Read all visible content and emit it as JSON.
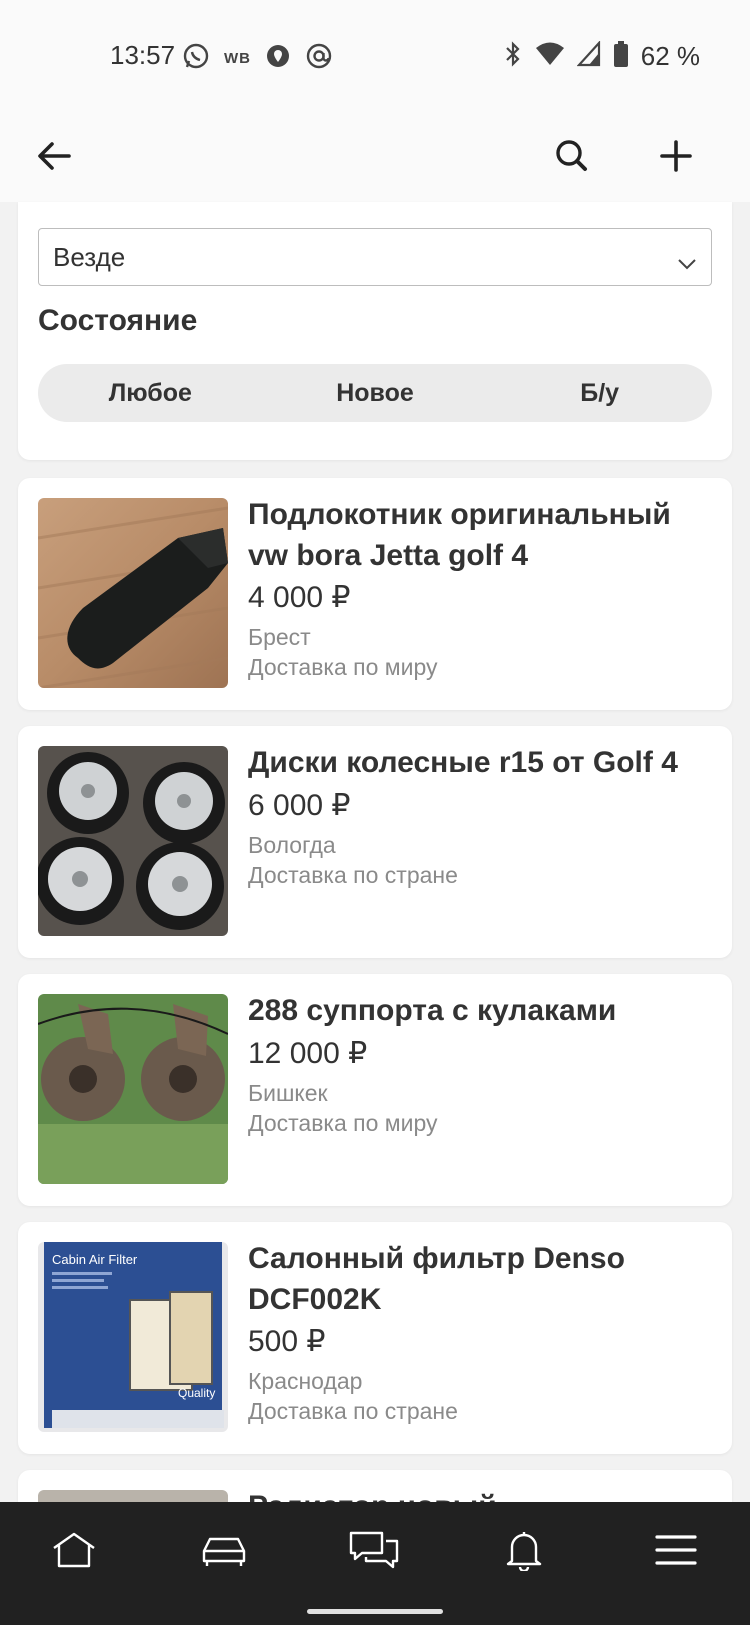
{
  "status_bar": {
    "time": "13:57",
    "wb_label": "WB",
    "battery": "62 %"
  },
  "app_bar": {
    "back_icon": "arrow-left-icon",
    "search_icon": "search-icon",
    "add_icon": "plus-icon"
  },
  "filters": {
    "location_value": "Везде",
    "condition_title": "Состояние",
    "condition_options": [
      "Любое",
      "Новое",
      "Б/у"
    ]
  },
  "listings": [
    {
      "title_line1": "Подлокотник оригинальный",
      "title_line2": "vw bora Jetta golf 4",
      "price": "4 000 ₽",
      "city": "Брест",
      "delivery": "Доставка по миру"
    },
    {
      "title_line1": "Диски колесные r15 от Golf 4",
      "title_line2": "",
      "price": "6 000 ₽",
      "city": "Вологда",
      "delivery": "Доставка по стране"
    },
    {
      "title_line1": "288 суппорта с кулаками",
      "title_line2": "",
      "price": "12 000 ₽",
      "city": "Бишкек",
      "delivery": "Доставка по миру"
    },
    {
      "title_line1": "Салонный фильтр Denso",
      "title_line2": "DCF002K",
      "price": "500 ₽",
      "city": "Краснодар",
      "delivery": "Доставка по стране",
      "image_text": "Cabin Air Filter",
      "image_brand": "Quality"
    },
    {
      "title_line1": "Радиатор новый",
      "title_line2": ""
    }
  ],
  "bottom_nav": {
    "items": [
      "home-icon",
      "car-icon",
      "chat-icon",
      "bell-icon",
      "menu-icon"
    ]
  },
  "colors": {
    "background": "#f2f2f2",
    "card": "#ffffff",
    "nav_bar": "#212121",
    "text_primary": "#333333",
    "text_secondary": "#8a8a8a"
  }
}
